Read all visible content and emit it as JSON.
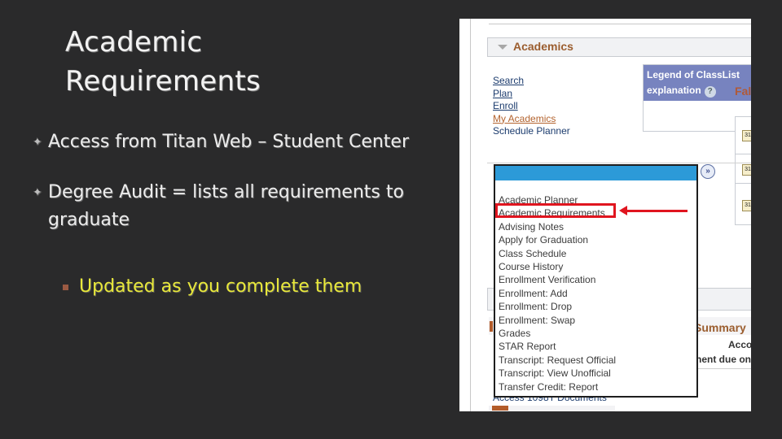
{
  "slide": {
    "title": "Academic Requirements",
    "bullets": [
      {
        "icon": "four-point-star-icon",
        "text": "Access from Titan Web – Student Center"
      },
      {
        "icon": "four-point-star-icon",
        "text": "Degree Audit = lists all requirements to graduate"
      }
    ],
    "sub_bullets": [
      {
        "icon": "square-bullet-icon",
        "text": "Updated as you complete them"
      }
    ],
    "colors": {
      "background": "#2a2a2b",
      "text": "#ececec",
      "sub_text": "#e8e83a",
      "highlight": "#e0151f"
    }
  },
  "screenshot": {
    "section_title": "Academics",
    "links": [
      {
        "label": "Search",
        "accesskey": "S"
      },
      {
        "label": "Plan",
        "accesskey": "P"
      },
      {
        "label": "Enroll",
        "accesskey": "E"
      },
      {
        "label": "My Academics",
        "active": true
      },
      {
        "label": "Schedule Planner"
      }
    ],
    "legend": {
      "line1": "Legend of ClassList",
      "line2": "explanation",
      "help": "?"
    },
    "term_partial": "Fal",
    "go_button": "»",
    "dropdown_items": [
      "Academic Planner",
      "Academic Requirements",
      "Advising Notes",
      "Apply for Graduation",
      "Class Schedule",
      "Course History",
      "Enrollment Verification",
      "Enrollment: Add",
      "Enrollment: Drop",
      "Enrollment: Swap",
      "Grades",
      "STAR Report",
      "Transcript: Request Official",
      "Transcript: View Unofficial",
      "Transfer Credit: Report"
    ],
    "highlighted_item": "Academic Requirements",
    "summary_partial": "Summary",
    "account_partial": "Accou",
    "due_partial": "nent due on",
    "access_link": "Access 1098T Documents",
    "calendar_icon_text": "31"
  }
}
